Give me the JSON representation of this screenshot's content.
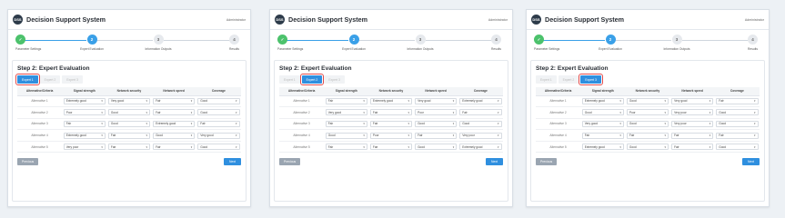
{
  "app": {
    "title": "Decision Support System",
    "logo_text": "DSS",
    "user": "Administrator"
  },
  "steps": [
    {
      "num": "✓",
      "label": "Parameter Settings",
      "state": "complete"
    },
    {
      "num": "2",
      "label": "Expert Evaluation",
      "state": "active"
    },
    {
      "num": "3",
      "label": "Information Outputs",
      "state": "pending"
    },
    {
      "num": "4",
      "label": "Results",
      "state": "pending"
    }
  ],
  "step_title": "Step 2: Expert Evaluation",
  "tabs": [
    "Expert 1",
    "Expert 2",
    "Expert 3"
  ],
  "columns": [
    "Alternative/Criteria",
    "Signal strength",
    "Network security",
    "Network speed",
    "Coverage"
  ],
  "alternatives": [
    "Alternative 1",
    "Alternative 2",
    "Alternative 3",
    "Alternative 4",
    "Alternative 5"
  ],
  "buttons": {
    "previous": "Previous",
    "next": "Next"
  },
  "panels": [
    {
      "active_tab": 0,
      "rows": [
        [
          "Extremely good",
          "Very good",
          "Fair",
          "Good"
        ],
        [
          "Poor",
          "Good",
          "Fair",
          "Good"
        ],
        [
          "Fair",
          "Good",
          "Extremely good",
          "Fair"
        ],
        [
          "Extremely good",
          "Fair",
          "Good",
          "Very good"
        ],
        [
          "Very poor",
          "Fair",
          "Fair",
          "Good"
        ]
      ]
    },
    {
      "active_tab": 1,
      "rows": [
        [
          "Fair",
          "Extremely good",
          "Very good",
          "Extremely good"
        ],
        [
          "Very good",
          "Fair",
          "Poor",
          "Fair"
        ],
        [
          "Fair",
          "Fair",
          "Good",
          "Good"
        ],
        [
          "Good",
          "Poor",
          "Fair",
          "Very poor"
        ],
        [
          "Fair",
          "Fair",
          "Good",
          "Extremely good"
        ]
      ]
    },
    {
      "active_tab": 2,
      "rows": [
        [
          "Extremely good",
          "Good",
          "Very good",
          "Fair"
        ],
        [
          "Good",
          "Poor",
          "Very poor",
          "Good"
        ],
        [
          "Very good",
          "Good",
          "Very poor",
          "Good"
        ],
        [
          "Fair",
          "Fair",
          "Fair",
          "Fair"
        ],
        [
          "Extremely good",
          "Good",
          "Fair",
          "Good"
        ]
      ]
    }
  ]
}
